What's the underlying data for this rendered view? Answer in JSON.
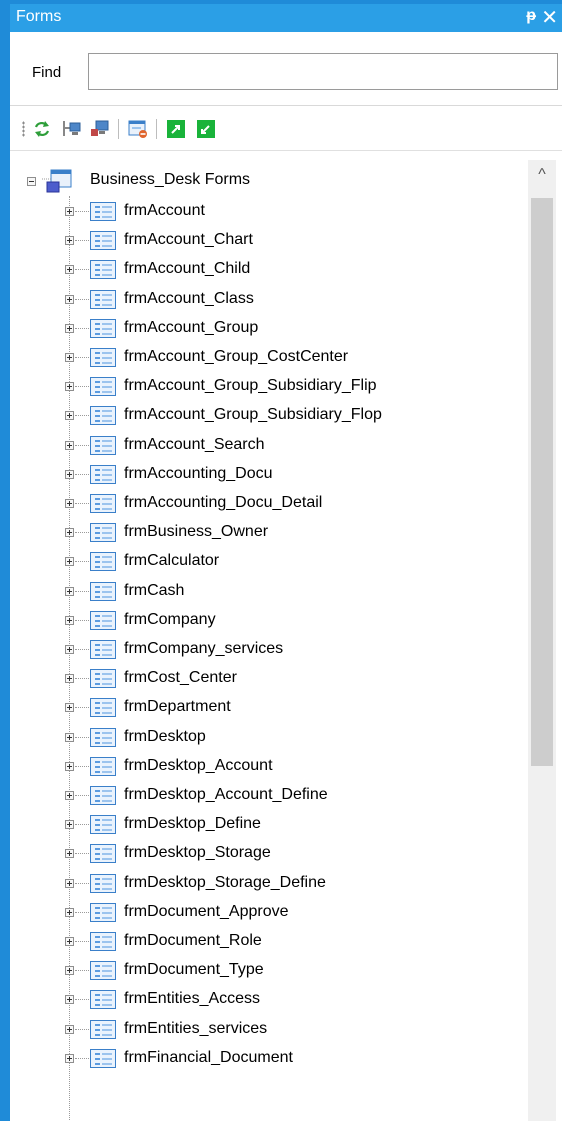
{
  "window": {
    "title": "Forms",
    "pin_glyph": "ᵽ",
    "close_glyph": "✕"
  },
  "find": {
    "label": "Find",
    "value": "",
    "placeholder": ""
  },
  "toolbar": {
    "buttons": [
      {
        "icon": "refresh-icon"
      },
      {
        "icon": "computer-tree-icon"
      },
      {
        "icon": "computer-swap-icon"
      },
      {
        "icon": "form-delete-icon"
      },
      {
        "icon": "green-export-icon"
      },
      {
        "icon": "green-import-icon"
      }
    ]
  },
  "tree": {
    "root_label": "Business_Desk Forms",
    "items": [
      "frmAccount",
      "frmAccount_Chart",
      "frmAccount_Child",
      "frmAccount_Class",
      "frmAccount_Group",
      "frmAccount_Group_CostCenter",
      "frmAccount_Group_Subsidiary_Flip",
      "frmAccount_Group_Subsidiary_Flop",
      "frmAccount_Search",
      "frmAccounting_Docu",
      "frmAccounting_Docu_Detail",
      "frmBusiness_Owner",
      "frmCalculator",
      "frmCash",
      "frmCompany",
      "frmCompany_services",
      "frmCost_Center",
      "frmDepartment",
      "frmDesktop",
      "frmDesktop_Account",
      "frmDesktop_Account_Define",
      "frmDesktop_Define",
      "frmDesktop_Storage",
      "frmDesktop_Storage_Define",
      "frmDocument_Approve",
      "frmDocument_Role",
      "frmDocument_Type",
      "frmEntities_Access",
      "frmEntities_services",
      "frmFinancial_Document"
    ]
  },
  "scrollbar": {
    "up_glyph": "^"
  }
}
